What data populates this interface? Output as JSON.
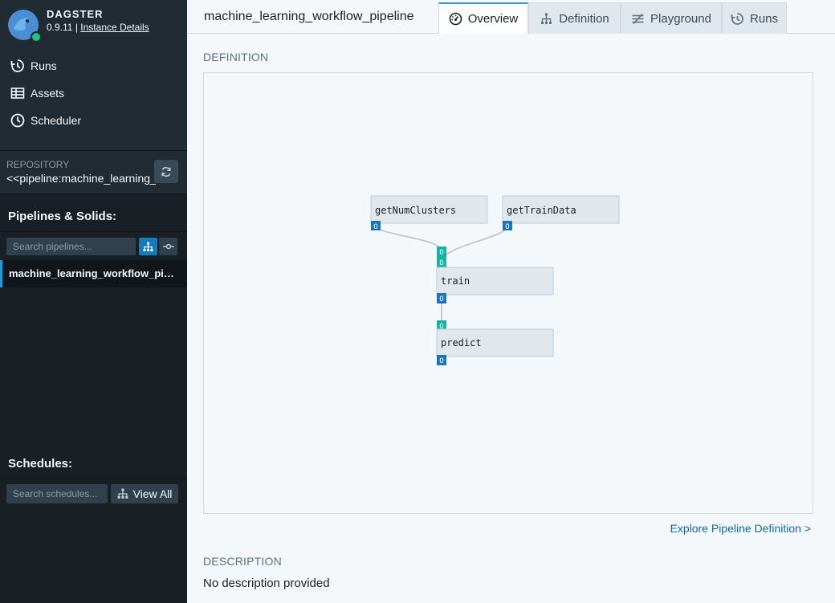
{
  "brand": {
    "title": "DAGSTER",
    "version": "0.9.11",
    "separator": "|",
    "instance_link": "Instance Details"
  },
  "nav": {
    "runs": "Runs",
    "assets": "Assets",
    "scheduler": "Scheduler"
  },
  "repository": {
    "label": "REPOSITORY",
    "name": "<<pipeline:machine_learning_workflow_pipeline>>"
  },
  "pipelines": {
    "title": "Pipelines & Solids:",
    "search_placeholder": "Search pipelines...",
    "items": [
      "machine_learning_workflow_pipeline"
    ]
  },
  "schedules": {
    "title": "Schedules:",
    "search_placeholder": "Search schedules...",
    "view_all": "View All"
  },
  "main": {
    "title": "machine_learning_workflow_pipeline",
    "tabs": [
      {
        "label": "Overview",
        "icon": "dashboard-icon"
      },
      {
        "label": "Definition",
        "icon": "diagram-tree-icon"
      },
      {
        "label": "Playground",
        "icon": "settings-icon"
      },
      {
        "label": "Runs",
        "icon": "history-icon"
      }
    ],
    "definition_label": "DEFINITION",
    "explore_link": "Explore Pipeline Definition >",
    "description_label": "DESCRIPTION",
    "description": "No description provided"
  },
  "graph": {
    "solids": [
      "getNumClusters",
      "getTrainData",
      "train",
      "predict"
    ],
    "port_label": "O"
  },
  "colors": {
    "accent": "#2b95d6",
    "input_port": "#15b3a0",
    "output_port": "#1c75b9",
    "sidebar": "#182026"
  }
}
